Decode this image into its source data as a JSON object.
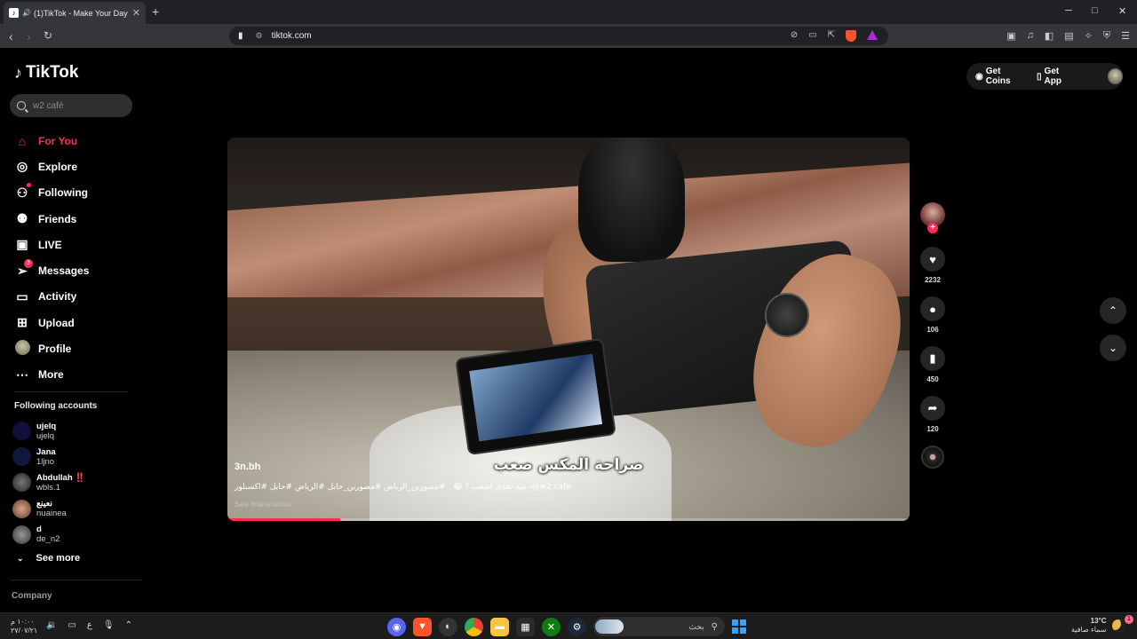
{
  "browser": {
    "tab_title": "(1)TikTok - Make Your Day",
    "url": "tiktok.com",
    "new_tab": "+",
    "close": "✕",
    "minimize": "─",
    "maximize": "□",
    "win_close": "✕"
  },
  "sidebar": {
    "logo": "TikTok",
    "search_placeholder": "w2 café",
    "nav": [
      {
        "label": "For You",
        "icon": "home-icon",
        "active": true
      },
      {
        "label": "Explore",
        "icon": "compass-icon"
      },
      {
        "label": "Following",
        "icon": "following-icon"
      },
      {
        "label": "Friends",
        "icon": "friends-icon"
      },
      {
        "label": "LIVE",
        "icon": "live-icon"
      },
      {
        "label": "Messages",
        "icon": "messages-icon",
        "badge": "3"
      },
      {
        "label": "Activity",
        "icon": "activity-icon"
      },
      {
        "label": "Upload",
        "icon": "upload-icon"
      },
      {
        "label": "Profile",
        "icon": "profile-icon"
      },
      {
        "label": "More",
        "icon": "more-icon"
      }
    ],
    "following_header": "Following accounts",
    "following": [
      {
        "name": "ujelq",
        "handle": "ujelq"
      },
      {
        "name": "Jana",
        "handle": "1ljno"
      },
      {
        "name": "Abdullah ‼️",
        "handle": "wbls.1"
      },
      {
        "name": "نعينع",
        "handle": "nuainea"
      },
      {
        "name": "d",
        "handle": "de_n2"
      }
    ],
    "see_more": "See more",
    "company": "Company"
  },
  "topbar": {
    "get_coins": "Get Coins",
    "get_app": "Get App"
  },
  "video": {
    "author": "3n.bh",
    "overlay_caption": "صراحة المكس صعب",
    "description": "مية تحدي اصعب ؟ 😂 . #مصورين_الرياض #مصورين_حايل #الرياض #حايل #اكسبلور -@w2 cafe",
    "see_translation": "See translation",
    "progress": 0.165
  },
  "actions": {
    "likes": "2232",
    "comments": "106",
    "saves": "450",
    "shares": "120"
  },
  "taskbar": {
    "time": "١٠:٠٠ م",
    "date": "٢٧/٠٧/٢١",
    "lang": "ع",
    "search_text": "بحث",
    "temp": "13°C",
    "weather": "سماء صافية",
    "notification_count": "1"
  }
}
